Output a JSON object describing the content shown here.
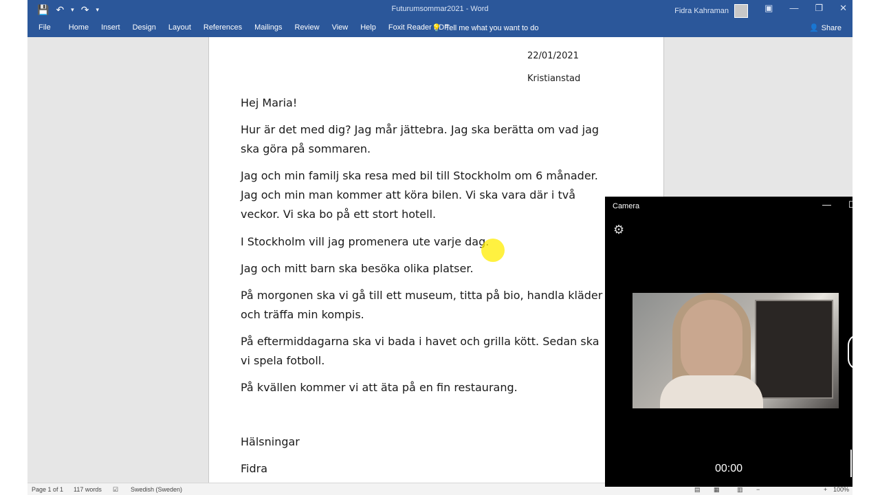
{
  "titlebar": {
    "doc_title": "Futurumsommar2021 - Word",
    "user_name": "Fidra Kahraman"
  },
  "ribbon": {
    "tabs": [
      "File",
      "Home",
      "Insert",
      "Design",
      "Layout",
      "References",
      "Mailings",
      "Review",
      "View",
      "Help",
      "Foxit Reader PDF"
    ],
    "tell_me": "Tell me what you want to do",
    "share": "Share"
  },
  "document": {
    "date": "22/01/2021",
    "place": "Kristianstad",
    "paragraphs": [
      "Hej Maria!",
      "Hur är det med dig? Jag mår jättebra.  Jag ska berätta om vad jag ska göra på sommaren.",
      "Jag och min familj ska resa med bil till Stockholm om 6 månader. Jag och min man kommer att köra bilen. Vi ska vara där i två veckor.   Vi ska bo på ett stort hotell.",
      "I Stockholm vill jag promenera ute varje dag.",
      "Jag och mitt barn ska besöka olika platser.",
      "På morgonen ska vi gå till ett museum, titta på bio, handla kläder och träffa min kompis.",
      "På eftermiddagarna ska vi bada i havet och grilla kött. Sedan ska vi spela fotboll.",
      "På kvällen kommer vi att äta på en fin restaurang.",
      "Hälsningar",
      "Fidra"
    ]
  },
  "statusbar": {
    "page": "Page 1 of 1",
    "words": "117 words",
    "language": "Swedish (Sweden)",
    "zoom": "100%"
  },
  "camera": {
    "title": "Camera",
    "timer": "00:00"
  },
  "icons": {
    "save": "save-icon",
    "undo": "undo-icon",
    "redo": "redo-icon",
    "lightbulb": "lightbulb-icon",
    "settings": "gear-icon"
  }
}
